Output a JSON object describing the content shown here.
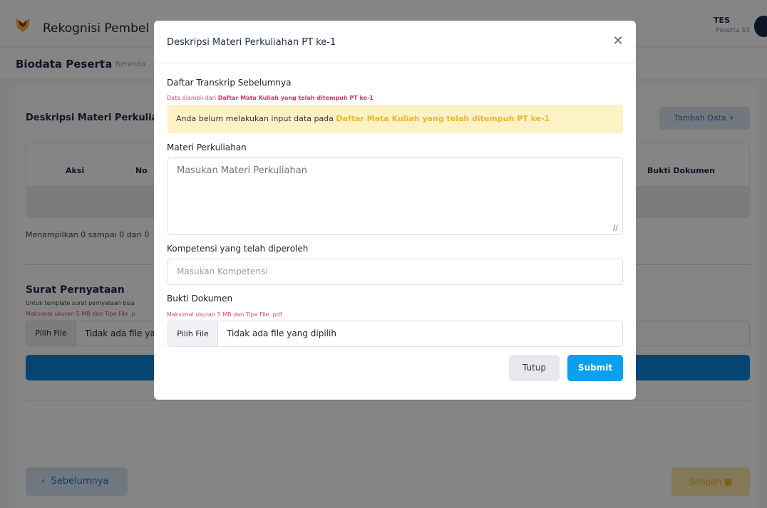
{
  "header": {
    "app_title": "Rekognisi Pembel",
    "user_name": "TES",
    "user_role": "Peserta S3"
  },
  "subheader": {
    "page_title": "Biodata Peserta",
    "breadcrumb": "Beranda"
  },
  "section": {
    "title": "Deskripsi Materi Perkuliahar",
    "add_button": "Tambah Data",
    "table_headers": [
      "Aksi",
      "No",
      "Bukti Dokumen"
    ],
    "showing": "Menampilkan 0 sampai 0 dari 0"
  },
  "statement": {
    "title": "Surat Pernyataan",
    "note": "Untuk template surat pernyataan bisa",
    "warn": "Maksimal ukuran 5 MB dan Tipe File .p",
    "file_button": "Pilih File",
    "file_text": "Tidak ada file ya"
  },
  "footer": {
    "prev_button": "Sebelumnya",
    "save_button": "Simpan"
  },
  "modal": {
    "title": "Deskripsi Materi Perkuliahan PT ke-1",
    "transcript_label": "Daftar Transkrip Sebelumnya",
    "transcript_note_prefix": "Data diambil dari ",
    "transcript_note_link": "Daftar Mata Kuliah yang telah ditempuh PT ke-1",
    "alert_prefix": "Anda belum melakukan input data pada ",
    "alert_link": "Daftar Mata Kuliah yang telah ditempuh PT ke-1",
    "materi_label": "Materi Perkuliahan",
    "materi_placeholder": "Masukan Materi Perkuliahan",
    "kompetensi_label": "Kompetensi yang telah diperoleh",
    "kompetensi_placeholder": "Masukan Kompetensi",
    "bukti_label": "Bukti Dokumen",
    "bukti_note": "Maksimal ukuran 5 MB dan Tipe File .pdf",
    "file_button": "Pilih File",
    "file_text": "Tidak ada file yang dipilih",
    "close_button": "Tutup",
    "submit_button": "Submit"
  },
  "colors": {
    "primary": "#0aa0f0",
    "warning_bg": "#fdf1c6",
    "warning_text": "#f0b62c",
    "danger": "#e0457b"
  }
}
